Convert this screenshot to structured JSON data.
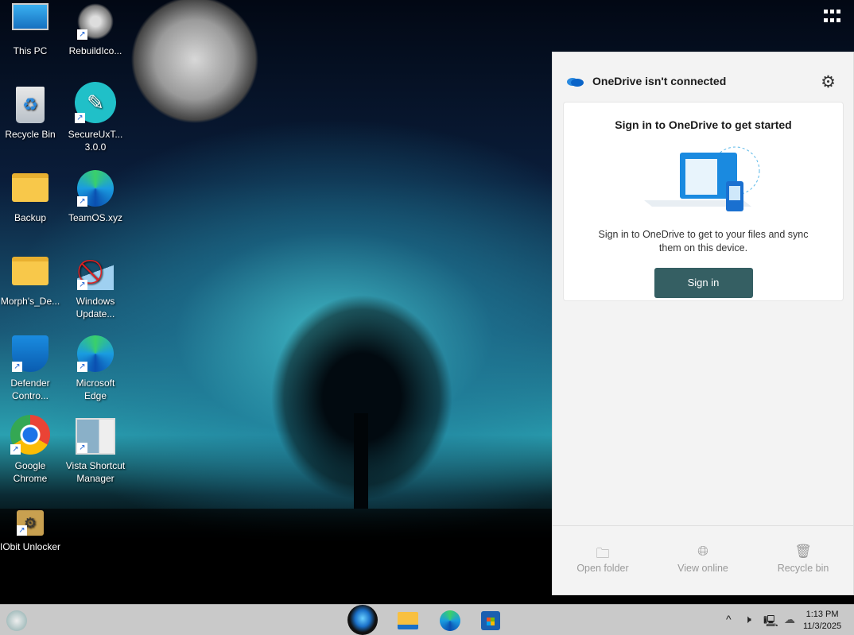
{
  "desktop": {
    "icons": [
      {
        "label": "This PC",
        "icon": "monitor-icon"
      },
      {
        "label": "RebuildIco...",
        "icon": "robot-icon"
      },
      {
        "label": "Recycle Bin",
        "icon": "recycle-bin-icon"
      },
      {
        "label": "SecureUxT... 3.0.0",
        "icon": "brush-icon"
      },
      {
        "label": "Backup",
        "icon": "folder-icon"
      },
      {
        "label": "TeamOS.xyz",
        "icon": "edge-icon"
      },
      {
        "label": "Morph's_De...",
        "icon": "folder-icon"
      },
      {
        "label": "Windows Update...",
        "icon": "windows-update-blocked-icon"
      },
      {
        "label": "Defender Contro...",
        "icon": "defender-icon"
      },
      {
        "label": "Microsoft Edge",
        "icon": "edge-icon"
      },
      {
        "label": "Google Chrome",
        "icon": "chrome-icon"
      },
      {
        "label": "Vista Shortcut Manager",
        "icon": "vista-shortcut-icon"
      },
      {
        "label": "IObit Unlocker",
        "icon": "unlock-icon"
      }
    ]
  },
  "onedrive": {
    "title": "OneDrive isn't connected",
    "heading": "Sign in to OneDrive to get started",
    "body": "Sign in to OneDrive to get to your files and sync them on this device.",
    "signin": "Sign in",
    "footer": [
      {
        "label": "Open folder",
        "icon": "folder-icon"
      },
      {
        "label": "View online",
        "icon": "globe-icon"
      },
      {
        "label": "Recycle bin",
        "icon": "trash-icon"
      }
    ],
    "accent": "#355f63"
  },
  "taskbar": {
    "time": "1:13 PM",
    "date": "11/3/2025",
    "apps": [
      "alienware-start",
      "file-explorer",
      "edge",
      "store"
    ]
  }
}
